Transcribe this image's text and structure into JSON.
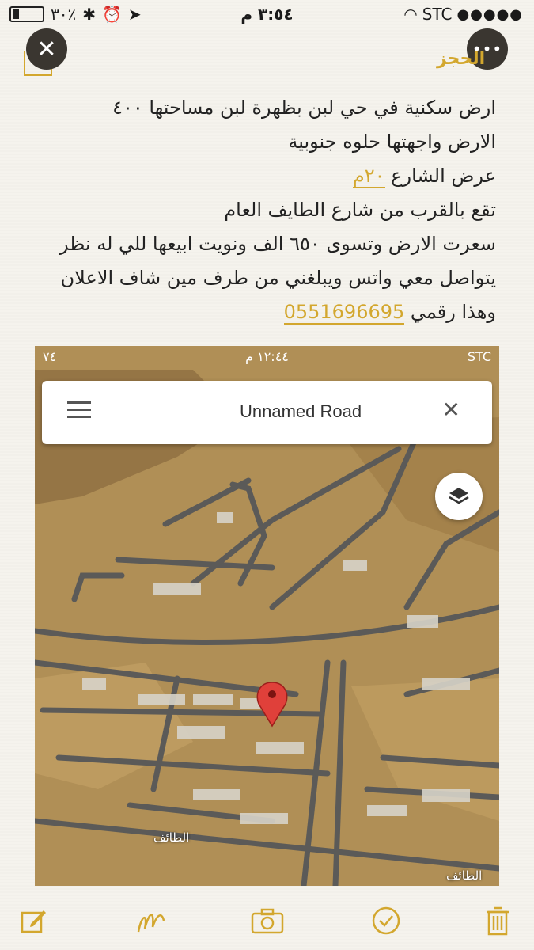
{
  "status_bar": {
    "carrier": "STC",
    "time": "٣:٥٤ م",
    "battery": "٣٠٪"
  },
  "nav": {
    "back_label": "الحجز"
  },
  "note": {
    "line1": "ارض سكنية في حي لبن بظهرة لبن مساحتها ٤٠٠",
    "line2": "الارض واجهتها حلوه جنوبية",
    "line3_prefix": "عرض الشارع ",
    "line3_value": "٢٠م",
    "line4": "تقع بالقرب من شارع الطايف العام",
    "line5": "سعرت الارض وتسوى ٦٥٠ الف ونويت ابيعها للي له نظر",
    "line6": "يتواصل معي واتس ويبلغني من طرف مين شاف الاعلان",
    "line7_prefix": "وهذا رقمي ",
    "phone": "0551696695"
  },
  "screenshot": {
    "status": {
      "carrier": "STC",
      "time": "١٢:٤٤ م",
      "battery": "٧٤"
    },
    "search_title": "Unnamed Road",
    "road_label_1": "الطائف",
    "road_label_2": "الطائف"
  },
  "toolbar": {
    "icons": [
      "compose-icon",
      "sketch-icon",
      "camera-icon",
      "checklist-icon",
      "trash-icon"
    ],
    "accent": "#d3a72e"
  }
}
